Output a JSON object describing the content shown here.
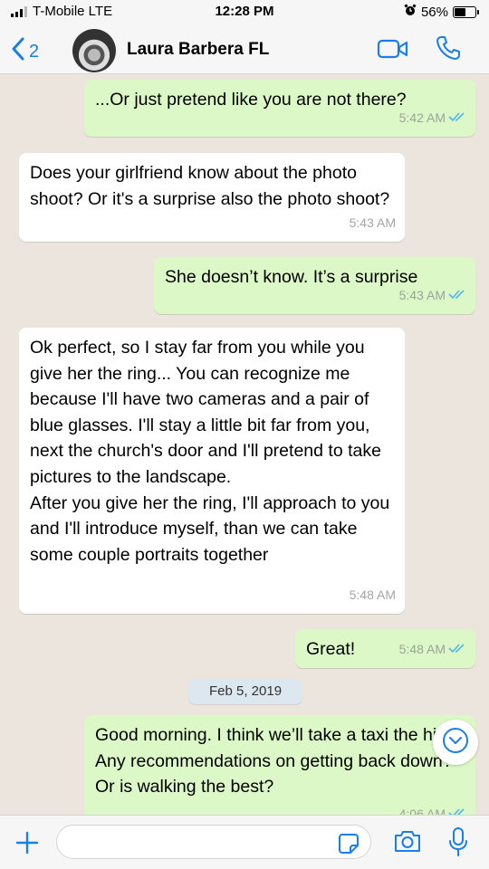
{
  "status_bar": {
    "carrier": "T-Mobile LTE",
    "time": "12:28 PM",
    "battery": "56%",
    "battery_level": 0.56
  },
  "header": {
    "back_count": "2",
    "contact_name": "Laura Barbera FL",
    "icons": [
      "chevron-left-icon",
      "video-call-icon",
      "phone-icon"
    ]
  },
  "messages": [
    {
      "direction": "out",
      "text": "...Or just pretend like you are not there?",
      "time": "5:42 AM",
      "read": true
    },
    {
      "direction": "in",
      "text": "Does your girlfriend know about the photo shoot? Or it's a surprise also the photo shoot?",
      "time": "5:43 AM"
    },
    {
      "direction": "out",
      "text": "She doesn’t know. It’s a surprise",
      "time": "5:43 AM",
      "read": true
    },
    {
      "direction": "in",
      "text": "Ok perfect, so I stay far from you while you give her the ring... You can recognize me because I'll have two cameras and a pair of blue glasses. I'll stay a little bit far from you, next the church's door and I'll pretend to take pictures to the landscape.\nAfter you give her the ring, I'll approach to you and I'll introduce myself, than we can take some couple portraits together",
      "time": "5:48 AM"
    },
    {
      "direction": "out",
      "text": "Great!",
      "time": "5:48 AM",
      "read": true
    },
    {
      "direction": "out",
      "text": "Good morning. I think we’ll take a taxi the hill. Any recommendations on getting back down? Or is walking the best?",
      "time": "4:06 AM",
      "read": true
    }
  ],
  "date_separator": "Feb 5, 2019",
  "input_bar": {
    "placeholder": "",
    "icons": [
      "plus-icon",
      "sticker-icon",
      "camera-icon",
      "microphone-icon"
    ]
  },
  "colors": {
    "accent": "#1a7ee8",
    "outgoing_bubble": "#dcf8c6",
    "incoming_bubble": "#ffffff",
    "chat_background": "#ece5dd",
    "read_ticks": "#4fb6ec"
  }
}
